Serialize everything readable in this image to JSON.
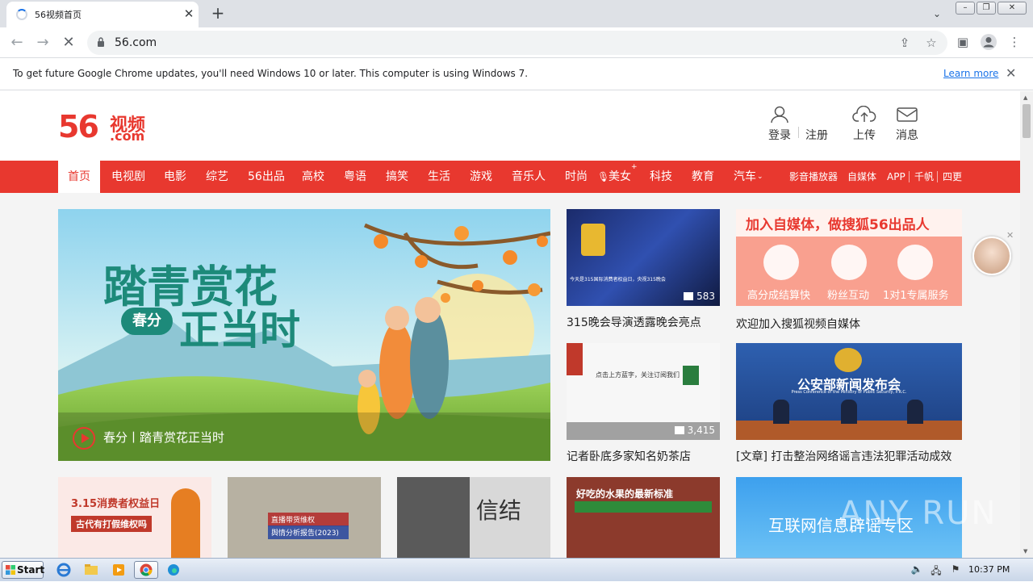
{
  "browser": {
    "tab_title": "56视频首页",
    "url": "56.com",
    "infobar_message": "To get future Google Chrome updates, you'll need Windows 10 or later. This computer is using Windows 7.",
    "infobar_link": "Learn more"
  },
  "site": {
    "logo_num": "56",
    "logo_cn": "视频",
    "logo_domain": ".com",
    "header": {
      "login": "登录",
      "register": "注册",
      "upload": "上传",
      "messages": "消息"
    },
    "nav": [
      "首页",
      "电视剧",
      "电影",
      "综艺",
      "56出品",
      "高校",
      "粤语",
      "搞笑",
      "生活",
      "游戏",
      "音乐人",
      "时尚",
      "美女",
      "科技",
      "教育",
      "汽车"
    ],
    "nav_right": [
      "影音播放器",
      "自媒体",
      "APP",
      "千帆",
      "四更"
    ],
    "hero": {
      "title_line1": "踏青赏花",
      "badge": "春分",
      "title_line2": "正当时",
      "caption": "春分丨踏青赏花正当时"
    },
    "cards": [
      {
        "caption": "315晚会导演透露晚会亮点",
        "count": "583",
        "overlay": "今天是315国际消费者权益日，央视315晚会"
      },
      {
        "caption": "欢迎加入搜狐视频自媒体",
        "ad_title": "加入自媒体，做搜狐56出品人",
        "ad_items": [
          "高分成结算快",
          "粉丝互动",
          "1对1专属服务"
        ]
      },
      {
        "caption": "记者卧底多家知名奶茶店",
        "count": "3,415",
        "overlay": "点击上方蓝字，关注订阅我们"
      },
      {
        "caption": "[文章] 打击整治网络谣言违法犯罪活动成效",
        "banner": "公安部新闻发布会",
        "banner_en": "Press Conference of the Ministry of Public Security, P.R.C."
      }
    ],
    "bottom": [
      {
        "text": "3.15消费者权益日",
        "sub": "古代有打假维权吗"
      },
      {
        "text": "直播带货维权",
        "sub": "舆情分析报告(2023)"
      },
      {
        "text": "信结"
      },
      {
        "text": "好吃的水果的最新标准"
      },
      {
        "text": "互联网信息辟谣专区"
      }
    ],
    "watermark": "ANY RUN"
  },
  "taskbar": {
    "start": "Start",
    "clock": "10:37 PM"
  }
}
